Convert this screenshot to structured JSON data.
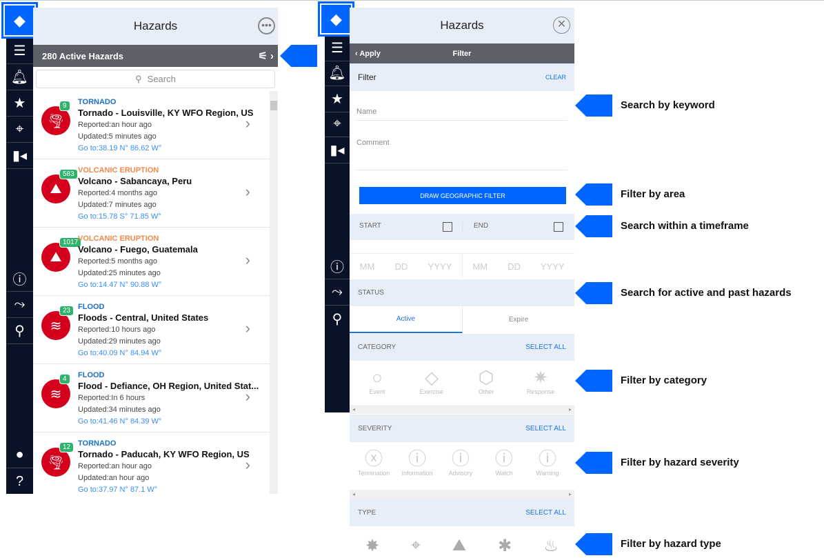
{
  "left": {
    "title": "Hazards",
    "count_label": "280 Active Hazards",
    "search_placeholder": "Search",
    "items": [
      {
        "category": "TORNADO",
        "cat_color": "#1a6fc4",
        "badge": "9",
        "title": "Tornado - Louisville, KY WFO Region, US",
        "reported": "Reported:an hour ago",
        "updated": "Updated:5 minutes ago",
        "goto": "Go to:38.19 N° 86.62 W°",
        "icon": "tornado-icon"
      },
      {
        "category": "VOLCANIC ERUPTION",
        "cat_color": "#f08a4b",
        "badge": "583",
        "title": "Volcano - Sabancaya, Peru",
        "reported": "Reported:4 months ago",
        "updated": "Updated:7 minutes ago",
        "goto": "Go to:15.78 S° 71.85 W°",
        "icon": "volcano-icon"
      },
      {
        "category": "VOLCANIC ERUPTION",
        "cat_color": "#f08a4b",
        "badge": "1017",
        "title": "Volcano - Fuego, Guatemala",
        "reported": "Reported:5 months ago",
        "updated": "Updated:25 minutes ago",
        "goto": "Go to:14.47 N° 90.88 W°",
        "icon": "volcano-icon"
      },
      {
        "category": "FLOOD",
        "cat_color": "#1a6fc4",
        "badge": "23",
        "title": "Floods - Central, United States",
        "reported": "Reported:10 hours ago",
        "updated": "Updated:29 minutes ago",
        "goto": "Go to:40.09 N° 84.94 W°",
        "icon": "flood-icon"
      },
      {
        "category": "FLOOD",
        "cat_color": "#1a6fc4",
        "badge": "4",
        "title": "Flood - Defiance, OH Region, United Stat...",
        "reported": "Reported:In 6 hours",
        "updated": "Updated:34 minutes ago",
        "goto": "Go to:41.46 N° 84.39 W°",
        "icon": "flood-icon"
      },
      {
        "category": "TORNADO",
        "cat_color": "#1a6fc4",
        "badge": "12",
        "title": "Tornado - Paducah, KY WFO Region, US",
        "reported": "Reported:an hour ago",
        "updated": "Updated:an hour ago",
        "goto": "Go to:37.97 N° 87.1 W°",
        "icon": "tornado-icon"
      }
    ]
  },
  "right": {
    "title": "Hazards",
    "apply": "Apply",
    "bar_title": "Filter",
    "filter_label": "Filter",
    "clear": "CLEAR",
    "name_placeholder": "Name",
    "comment_placeholder": "Comment",
    "draw_button": "DRAW GEOGRAPHIC FILTER",
    "start": "START",
    "end": "END",
    "mm": "MM",
    "dd": "DD",
    "yyyy": "YYYY",
    "status": "STATUS",
    "tab_active": "Active",
    "tab_expire": "Expire",
    "category": "CATEGORY",
    "severity": "SEVERITY",
    "type": "TYPE",
    "select_all": "SELECT ALL",
    "categories": [
      "Event",
      "Exercise",
      "Other",
      "Response"
    ],
    "severities": [
      "Termination",
      "Information",
      "Advisory",
      "Watch",
      "Warning"
    ]
  },
  "callouts": [
    "Search by keyword",
    "Filter by area",
    "Search within a timeframe",
    "Search for active and past hazards",
    "Filter by category",
    "Filter by hazard severity",
    "Filter by hazard type"
  ],
  "colors": {
    "accent": "#0066ff",
    "sidebar": "#0a1228",
    "hazard_red": "#d5001c",
    "badge_green": "#2db36b"
  }
}
